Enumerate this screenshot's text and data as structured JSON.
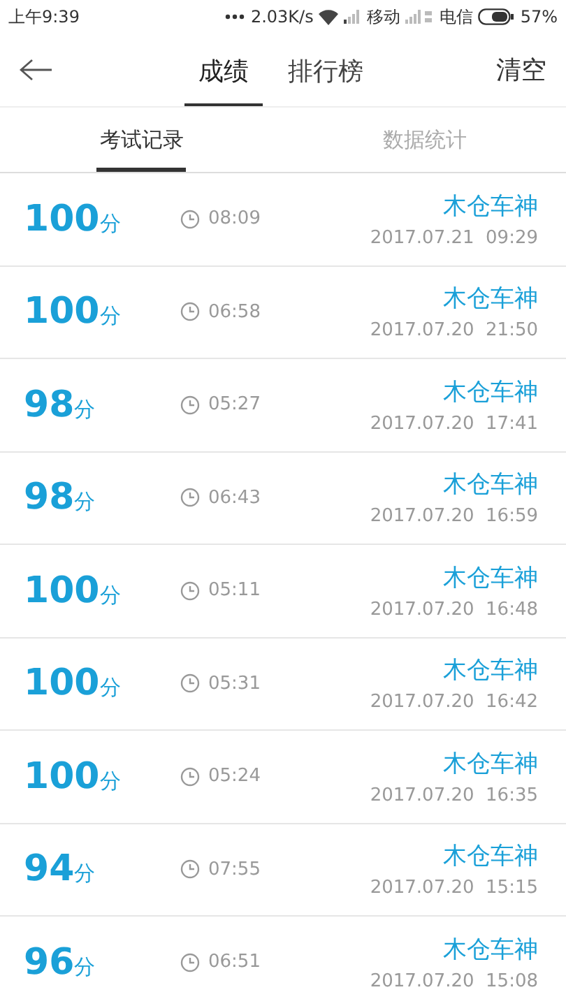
{
  "status_bar": {
    "time": "上午9:39",
    "speed": "2.03K/s",
    "carrier_1": "移动",
    "carrier_2": "电信",
    "battery": "57%"
  },
  "header": {
    "tabs": [
      {
        "label": "成绩",
        "selected": true
      },
      {
        "label": "排行榜",
        "selected": false
      }
    ],
    "action": "清空"
  },
  "subtabs": [
    {
      "label": "考试记录",
      "selected": true
    },
    {
      "label": "数据统计",
      "selected": false
    }
  ],
  "records": [
    {
      "score": "100",
      "unit": "分",
      "duration": "08:09",
      "name": "木仓车神",
      "date": "2017.07.21  09:29"
    },
    {
      "score": "100",
      "unit": "分",
      "duration": "06:58",
      "name": "木仓车神",
      "date": "2017.07.20  21:50"
    },
    {
      "score": "98",
      "unit": "分",
      "duration": "05:27",
      "name": "木仓车神",
      "date": "2017.07.20  17:41"
    },
    {
      "score": "98",
      "unit": "分",
      "duration": "06:43",
      "name": "木仓车神",
      "date": "2017.07.20  16:59"
    },
    {
      "score": "100",
      "unit": "分",
      "duration": "05:11",
      "name": "木仓车神",
      "date": "2017.07.20  16:48"
    },
    {
      "score": "100",
      "unit": "分",
      "duration": "05:31",
      "name": "木仓车神",
      "date": "2017.07.20  16:42"
    },
    {
      "score": "100",
      "unit": "分",
      "duration": "05:24",
      "name": "木仓车神",
      "date": "2017.07.20  16:35"
    },
    {
      "score": "94",
      "unit": "分",
      "duration": "07:55",
      "name": "木仓车神",
      "date": "2017.07.20  15:15"
    },
    {
      "score": "96",
      "unit": "分",
      "duration": "06:51",
      "name": "木仓车神",
      "date": "2017.07.20  15:08"
    }
  ]
}
